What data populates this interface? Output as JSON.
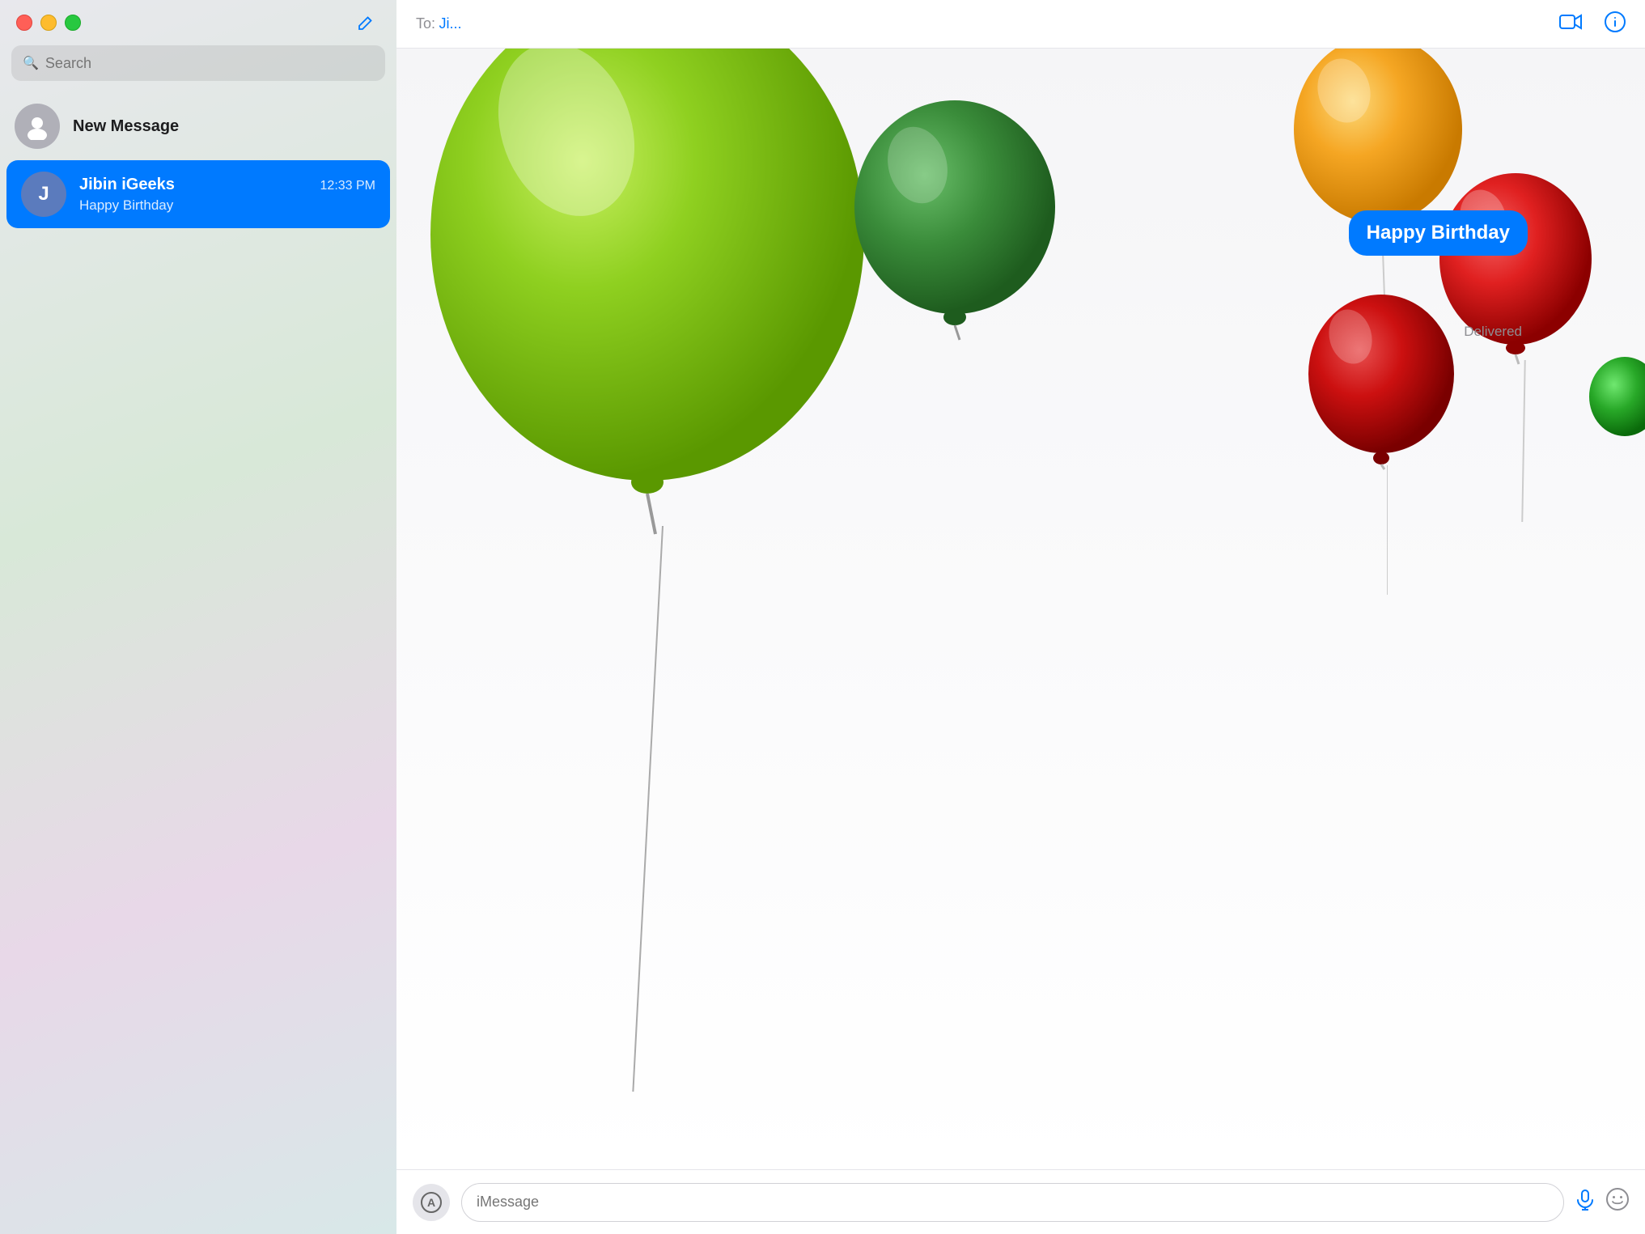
{
  "sidebar": {
    "search_placeholder": "Search",
    "compose_icon": "✏",
    "new_message": {
      "label": "New Message"
    },
    "conversations": [
      {
        "id": "jibin",
        "name": "Jibin iGeeks",
        "preview": "Happy Birthday",
        "time": "12:33 PM",
        "initial": "J",
        "selected": true
      }
    ]
  },
  "chat": {
    "header": {
      "to_label": "To:",
      "contact_name": "Ji...",
      "video_icon": "📹",
      "info_icon": "ℹ"
    },
    "message_bubble": {
      "text": "Happy Birthday",
      "status": "Delivered"
    },
    "input": {
      "placeholder": "iMessage",
      "apps_icon": "A",
      "audio_icon": "🎤",
      "emoji_icon": "😊"
    }
  },
  "balloons": {
    "big_green": {
      "color": "#7dc832",
      "highlight": "#b5e86a"
    },
    "small_green": {
      "color": "#3a8c3a",
      "highlight": "#5cad5c"
    },
    "orange": {
      "color": "#f5a623",
      "highlight": "#f8c96a"
    },
    "red_right": {
      "color": "#e02020",
      "highlight": "#f26060"
    },
    "red_lower": {
      "color": "#cc1010",
      "highlight": "#e85050"
    },
    "green_edge": {
      "color": "#28a828",
      "highlight": "#50cc50"
    }
  }
}
